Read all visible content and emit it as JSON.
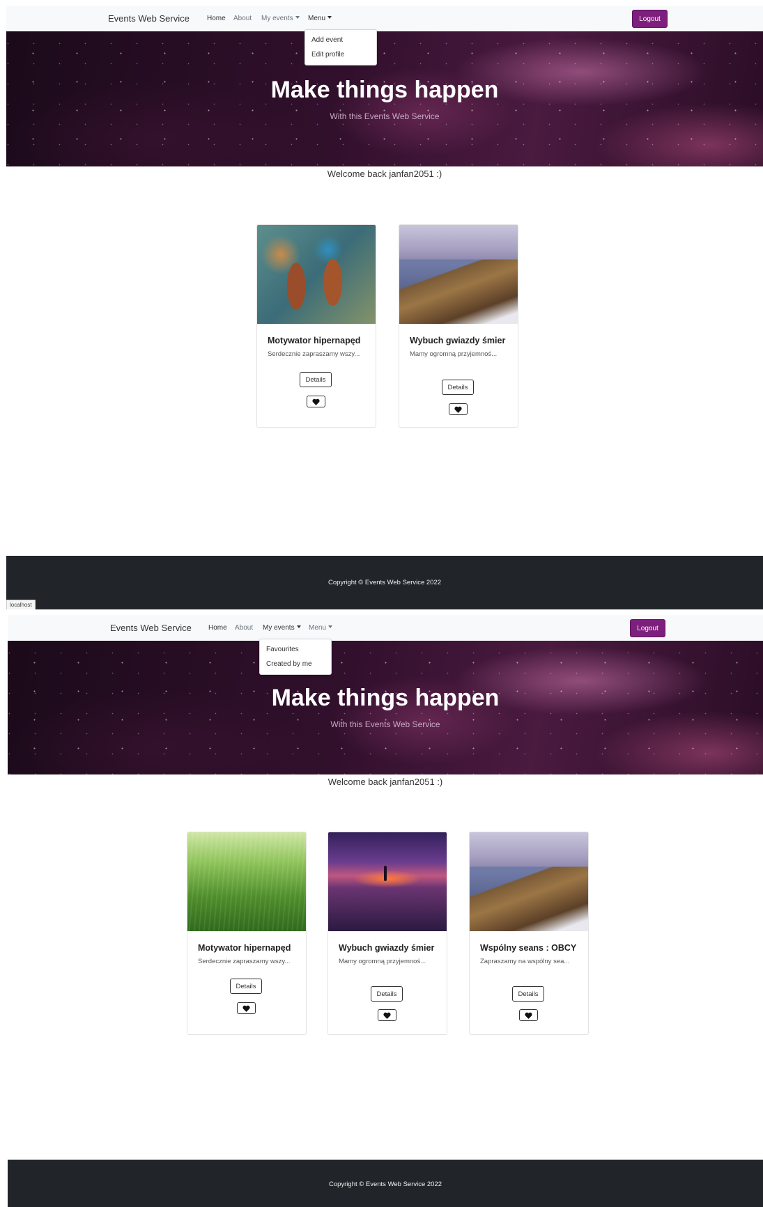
{
  "nav": {
    "brand": "Events Web Service",
    "home": "Home",
    "about": "About",
    "my_events": "My events",
    "menu": "Menu",
    "logout": "Logout"
  },
  "menu_dropdown": {
    "add_event": "Add event",
    "edit_profile": "Edit profile"
  },
  "my_events_dropdown": {
    "favourites": "Favourites",
    "created_by_me": "Created by me"
  },
  "hero": {
    "title": "Make things happen",
    "subtitle": "With this Events Web Service"
  },
  "welcome": "Welcome back janfan2051 :)",
  "cards_top": [
    {
      "title": "Motywator hipernapęd",
      "desc": "Serdecznie zapraszamy wszy...",
      "details": "Details"
    },
    {
      "title": "Wybuch gwiazdy śmier",
      "desc": "Mamy ogromną przyjemnoś...",
      "details": "Details"
    }
  ],
  "cards_bottom": [
    {
      "title": "Motywator hipernapęd",
      "desc": "Serdecznie zapraszamy wszy...",
      "details": "Details"
    },
    {
      "title": "Wybuch gwiazdy śmier",
      "desc": "Mamy ogromną przyjemnoś...",
      "details": "Details"
    },
    {
      "title": "Wspólny seans : OBCY",
      "desc": "Zapraszamy na wspólny sea...",
      "details": "Details"
    }
  ],
  "footer": {
    "copyright": "Copyright © Events Web Service 2022"
  },
  "tooltip": "localhost",
  "colors": {
    "logout_bg": "#7d1f7c",
    "footer_bg": "#212529",
    "navbar_bg": "#f8f9fa"
  }
}
